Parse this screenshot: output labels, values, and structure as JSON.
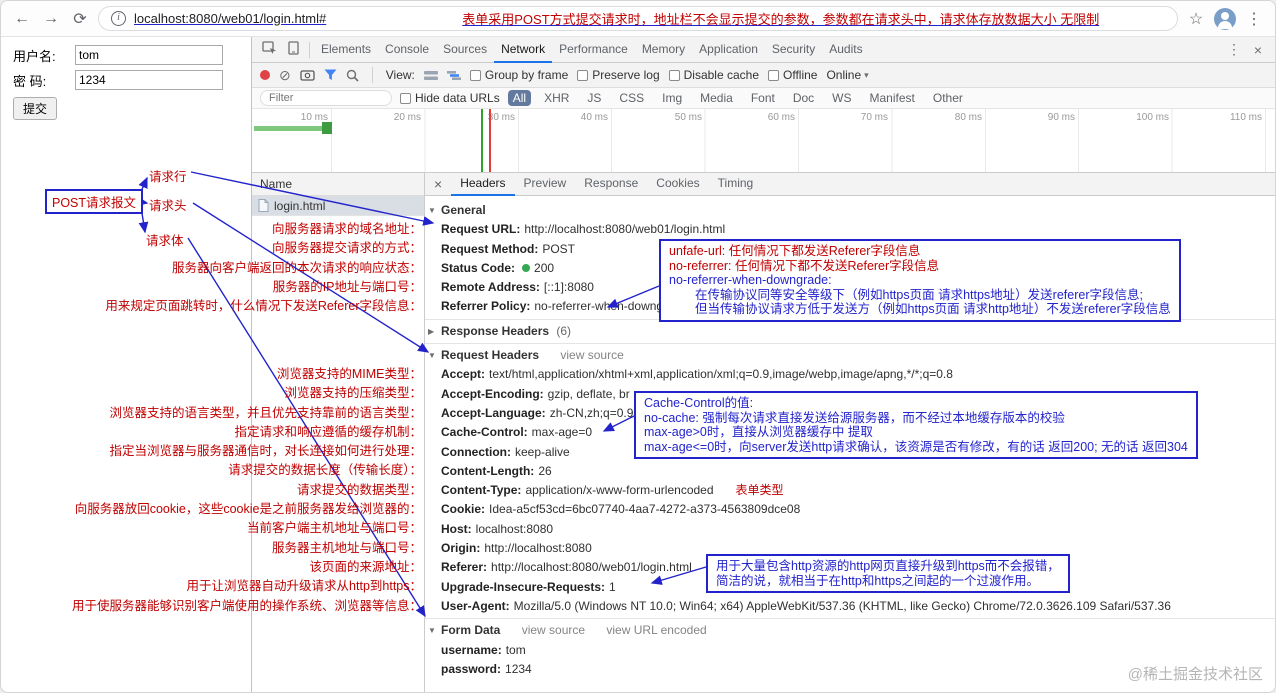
{
  "icons": {
    "back": "←",
    "forward": "→",
    "reload": "⟳",
    "info": "i",
    "star": "☆",
    "menu": "⋮",
    "clear": "⊘",
    "close": "×",
    "caret": "▾",
    "tri_down": "▼",
    "tri_right": "▶"
  },
  "browser": {
    "url": "localhost:8080/web01/login.html#",
    "note": "表单采用POST方式提交请求时，地址栏不会显示提交的参数，参数都在请求头中，请求体存放数据大小 无限制"
  },
  "page_form": {
    "username_label": "用户名:",
    "username_value": "tom",
    "password_label": "密 码:",
    "password_value": "1234",
    "submit_label": "提交"
  },
  "devtools": {
    "tabs": [
      "Elements",
      "Console",
      "Sources",
      "Network",
      "Performance",
      "Memory",
      "Application",
      "Security",
      "Audits"
    ],
    "toolbar": {
      "view_label": "View:",
      "group_by_frame": "Group by frame",
      "preserve_log": "Preserve log",
      "disable_cache": "Disable cache",
      "offline": "Offline",
      "online": "Online"
    },
    "filter": {
      "placeholder": "Filter",
      "hide_data_urls": "Hide data URLs",
      "types": [
        "All",
        "XHR",
        "JS",
        "CSS",
        "Img",
        "Media",
        "Font",
        "Doc",
        "WS",
        "Manifest",
        "Other"
      ]
    },
    "timeline_ticks": [
      "10 ms",
      "20 ms",
      "30 ms",
      "40 ms",
      "50 ms",
      "60 ms",
      "70 ms",
      "80 ms",
      "90 ms",
      "100 ms",
      "110 ms"
    ],
    "requests": {
      "name_header": "Name",
      "row0": "login.html"
    },
    "detail_tabs": [
      "Headers",
      "Preview",
      "Response",
      "Cookies",
      "Timing"
    ],
    "headers_pane": {
      "general_title": "General",
      "general": [
        {
          "name": "Request URL:",
          "value": "http://localhost:8080/web01/login.html"
        },
        {
          "name": "Request Method:",
          "value": "POST"
        },
        {
          "name": "Status Code:",
          "value": "200"
        },
        {
          "name": "Remote Address:",
          "value": "[::1]:8080"
        },
        {
          "name": "Referrer Policy:",
          "value": "no-referrer-when-downgrade"
        }
      ],
      "response_headers_title": "Response Headers",
      "response_headers_count": "(6)",
      "request_headers_title": "Request Headers",
      "view_source": "view source",
      "request_headers": [
        {
          "name": "Accept:",
          "value": "text/html,application/xhtml+xml,application/xml;q=0.9,image/webp,image/apng,*/*;q=0.8"
        },
        {
          "name": "Accept-Encoding:",
          "value": "gzip, deflate, br"
        },
        {
          "name": "Accept-Language:",
          "value": "zh-CN,zh;q=0.9"
        },
        {
          "name": "Cache-Control:",
          "value": "max-age=0"
        },
        {
          "name": "Connection:",
          "value": "keep-alive"
        },
        {
          "name": "Content-Length:",
          "value": "26"
        },
        {
          "name": "Content-Type:",
          "value": "application/x-www-form-urlencoded"
        },
        {
          "name": "Cookie:",
          "value": "Idea-a5cf53cd=6bc07740-4aa7-4272-a373-4563809dce08"
        },
        {
          "name": "Host:",
          "value": "localhost:8080"
        },
        {
          "name": "Origin:",
          "value": "http://localhost:8080"
        },
        {
          "name": "Referer:",
          "value": "http://localhost:8080/web01/login.html"
        },
        {
          "name": "Upgrade-Insecure-Requests:",
          "value": "1"
        },
        {
          "name": "User-Agent:",
          "value": "Mozilla/5.0 (Windows NT 10.0; Win64; x64) AppleWebKit/537.36 (KHTML, like Gecko) Chrome/72.0.3626.109 Safari/537.36"
        }
      ],
      "form_data_title": "Form Data",
      "view_url_encoded": "view URL encoded",
      "form_data": [
        {
          "name": "username:",
          "value": "tom"
        },
        {
          "name": "password:",
          "value": "1234"
        }
      ]
    }
  },
  "annotations": {
    "post_label": "POST请求报文",
    "request_line": "请求行",
    "request_head": "请求头",
    "request_body": "请求体",
    "content_type_note": "表单类型",
    "general_notes": [
      "向服务器请求的域名地址：",
      "向服务器提交请求的方式：",
      "服务器向客户端返回的本次请求的响应状态：",
      "服务器的IP地址与端口号：",
      "用来规定页面跳转时，什么情况下发送Referer字段信息："
    ],
    "header_notes": [
      "浏览器支持的MIME类型：",
      "浏览器支持的压缩类型：",
      "浏览器支持的语言类型，并且优先支持靠前的语言类型：",
      "指定请求和响应遵循的缓存机制：",
      "指定当浏览器与服务器通信时，对长连接如何进行处理：",
      "请求提交的数据长度（传输长度）：",
      "请求提交的数据类型：",
      "向服务器放回cookie，这些cookie是之前服务器发给浏览器的：",
      "当前客户端主机地址与端口号：",
      "服务器主机地址与端口号：",
      "该页面的来源地址：",
      "用于让浏览器自动升级请求从http到https：",
      "用于使服务器能够识别客户端使用的操作系统、浏览器等信息："
    ],
    "referrer_box": {
      "red1": "unfafe-url: 任何情况下都发送Referer字段信息",
      "red2": "no-referrer: 任何情况下都不发送Referer字段信息",
      "blue1": "no-referrer-when-downgrade:",
      "blue2": "在传输协议同等安全等级下（例如https页面 请求https地址）发送referer字段信息;",
      "blue3": "但当传输协议请求方低于发送方（例如https页面 请求http地址）不发送referer字段信息"
    },
    "cache_box": {
      "line1": "Cache-Control的值:",
      "line2": "no-cache: 强制每次请求直接发送给源服务器，而不经过本地缓存版本的校验",
      "line3": "max-age>0时，直接从浏览器缓存中 提取",
      "line4": "max-age<=0时，向server发送http请求确认，该资源是否有修改，有的话 返回200; 无的话 返回304"
    },
    "upgrade_box": {
      "line1": "用于大量包含http资源的http网页直接升级到https而不会报错，",
      "line2": "简洁的说，就相当于在http和https之间起的一个过渡作用。"
    }
  },
  "watermark": "@稀土掘金技术社区",
  "colors": {
    "annotation_red": "#c00000",
    "annotation_blue": "#2323cc",
    "accent_blue": "#1a73e8",
    "status_green": "#35a853",
    "record_red": "#e04343"
  }
}
